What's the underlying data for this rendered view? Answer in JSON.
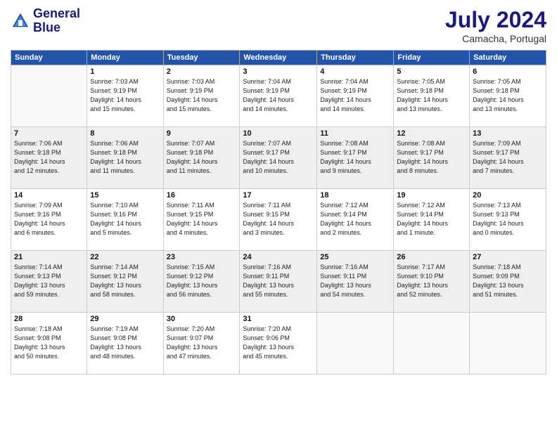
{
  "header": {
    "logo_line1": "General",
    "logo_line2": "Blue",
    "month_title": "July 2024",
    "location": "Camacha, Portugal"
  },
  "weekdays": [
    "Sunday",
    "Monday",
    "Tuesday",
    "Wednesday",
    "Thursday",
    "Friday",
    "Saturday"
  ],
  "weeks": [
    [
      {
        "day": "",
        "info": ""
      },
      {
        "day": "1",
        "info": "Sunrise: 7:03 AM\nSunset: 9:19 PM\nDaylight: 14 hours\nand 15 minutes."
      },
      {
        "day": "2",
        "info": "Sunrise: 7:03 AM\nSunset: 9:19 PM\nDaylight: 14 hours\nand 15 minutes."
      },
      {
        "day": "3",
        "info": "Sunrise: 7:04 AM\nSunset: 9:19 PM\nDaylight: 14 hours\nand 14 minutes."
      },
      {
        "day": "4",
        "info": "Sunrise: 7:04 AM\nSunset: 9:19 PM\nDaylight: 14 hours\nand 14 minutes."
      },
      {
        "day": "5",
        "info": "Sunrise: 7:05 AM\nSunset: 9:18 PM\nDaylight: 14 hours\nand 13 minutes."
      },
      {
        "day": "6",
        "info": "Sunrise: 7:05 AM\nSunset: 9:18 PM\nDaylight: 14 hours\nand 13 minutes."
      }
    ],
    [
      {
        "day": "7",
        "info": "Sunrise: 7:06 AM\nSunset: 9:18 PM\nDaylight: 14 hours\nand 12 minutes."
      },
      {
        "day": "8",
        "info": "Sunrise: 7:06 AM\nSunset: 9:18 PM\nDaylight: 14 hours\nand 11 minutes."
      },
      {
        "day": "9",
        "info": "Sunrise: 7:07 AM\nSunset: 9:18 PM\nDaylight: 14 hours\nand 11 minutes."
      },
      {
        "day": "10",
        "info": "Sunrise: 7:07 AM\nSunset: 9:17 PM\nDaylight: 14 hours\nand 10 minutes."
      },
      {
        "day": "11",
        "info": "Sunrise: 7:08 AM\nSunset: 9:17 PM\nDaylight: 14 hours\nand 9 minutes."
      },
      {
        "day": "12",
        "info": "Sunrise: 7:08 AM\nSunset: 9:17 PM\nDaylight: 14 hours\nand 8 minutes."
      },
      {
        "day": "13",
        "info": "Sunrise: 7:09 AM\nSunset: 9:17 PM\nDaylight: 14 hours\nand 7 minutes."
      }
    ],
    [
      {
        "day": "14",
        "info": "Sunrise: 7:09 AM\nSunset: 9:16 PM\nDaylight: 14 hours\nand 6 minutes."
      },
      {
        "day": "15",
        "info": "Sunrise: 7:10 AM\nSunset: 9:16 PM\nDaylight: 14 hours\nand 5 minutes."
      },
      {
        "day": "16",
        "info": "Sunrise: 7:11 AM\nSunset: 9:15 PM\nDaylight: 14 hours\nand 4 minutes."
      },
      {
        "day": "17",
        "info": "Sunrise: 7:11 AM\nSunset: 9:15 PM\nDaylight: 14 hours\nand 3 minutes."
      },
      {
        "day": "18",
        "info": "Sunrise: 7:12 AM\nSunset: 9:14 PM\nDaylight: 14 hours\nand 2 minutes."
      },
      {
        "day": "19",
        "info": "Sunrise: 7:12 AM\nSunset: 9:14 PM\nDaylight: 14 hours\nand 1 minute."
      },
      {
        "day": "20",
        "info": "Sunrise: 7:13 AM\nSunset: 9:13 PM\nDaylight: 14 hours\nand 0 minutes."
      }
    ],
    [
      {
        "day": "21",
        "info": "Sunrise: 7:14 AM\nSunset: 9:13 PM\nDaylight: 13 hours\nand 59 minutes."
      },
      {
        "day": "22",
        "info": "Sunrise: 7:14 AM\nSunset: 9:12 PM\nDaylight: 13 hours\nand 58 minutes."
      },
      {
        "day": "23",
        "info": "Sunrise: 7:15 AM\nSunset: 9:12 PM\nDaylight: 13 hours\nand 56 minutes."
      },
      {
        "day": "24",
        "info": "Sunrise: 7:16 AM\nSunset: 9:11 PM\nDaylight: 13 hours\nand 55 minutes."
      },
      {
        "day": "25",
        "info": "Sunrise: 7:16 AM\nSunset: 9:11 PM\nDaylight: 13 hours\nand 54 minutes."
      },
      {
        "day": "26",
        "info": "Sunrise: 7:17 AM\nSunset: 9:10 PM\nDaylight: 13 hours\nand 52 minutes."
      },
      {
        "day": "27",
        "info": "Sunrise: 7:18 AM\nSunset: 9:09 PM\nDaylight: 13 hours\nand 51 minutes."
      }
    ],
    [
      {
        "day": "28",
        "info": "Sunrise: 7:18 AM\nSunset: 9:08 PM\nDaylight: 13 hours\nand 50 minutes."
      },
      {
        "day": "29",
        "info": "Sunrise: 7:19 AM\nSunset: 9:08 PM\nDaylight: 13 hours\nand 48 minutes."
      },
      {
        "day": "30",
        "info": "Sunrise: 7:20 AM\nSunset: 9:07 PM\nDaylight: 13 hours\nand 47 minutes."
      },
      {
        "day": "31",
        "info": "Sunrise: 7:20 AM\nSunset: 9:06 PM\nDaylight: 13 hours\nand 45 minutes."
      },
      {
        "day": "",
        "info": ""
      },
      {
        "day": "",
        "info": ""
      },
      {
        "day": "",
        "info": ""
      }
    ]
  ]
}
